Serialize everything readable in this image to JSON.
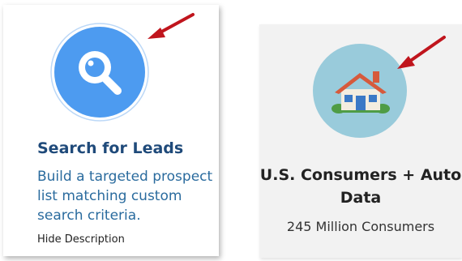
{
  "search_card": {
    "title": "Search for Leads",
    "description": "Build a targeted prospect list matching custom search criteria.",
    "hide_link": "Hide Description",
    "icon": "search-icon"
  },
  "consumer_card": {
    "title": "U.S. Consumers + Auto Data",
    "subtitle": "245 Million Consumers",
    "icon": "house-icon"
  },
  "colors": {
    "search_circle": "#4d9bf0",
    "house_circle": "#99cbdb",
    "arrow": "#c0151d",
    "title_blue": "#1f4a7a",
    "link_blue": "#2a6b9e"
  }
}
